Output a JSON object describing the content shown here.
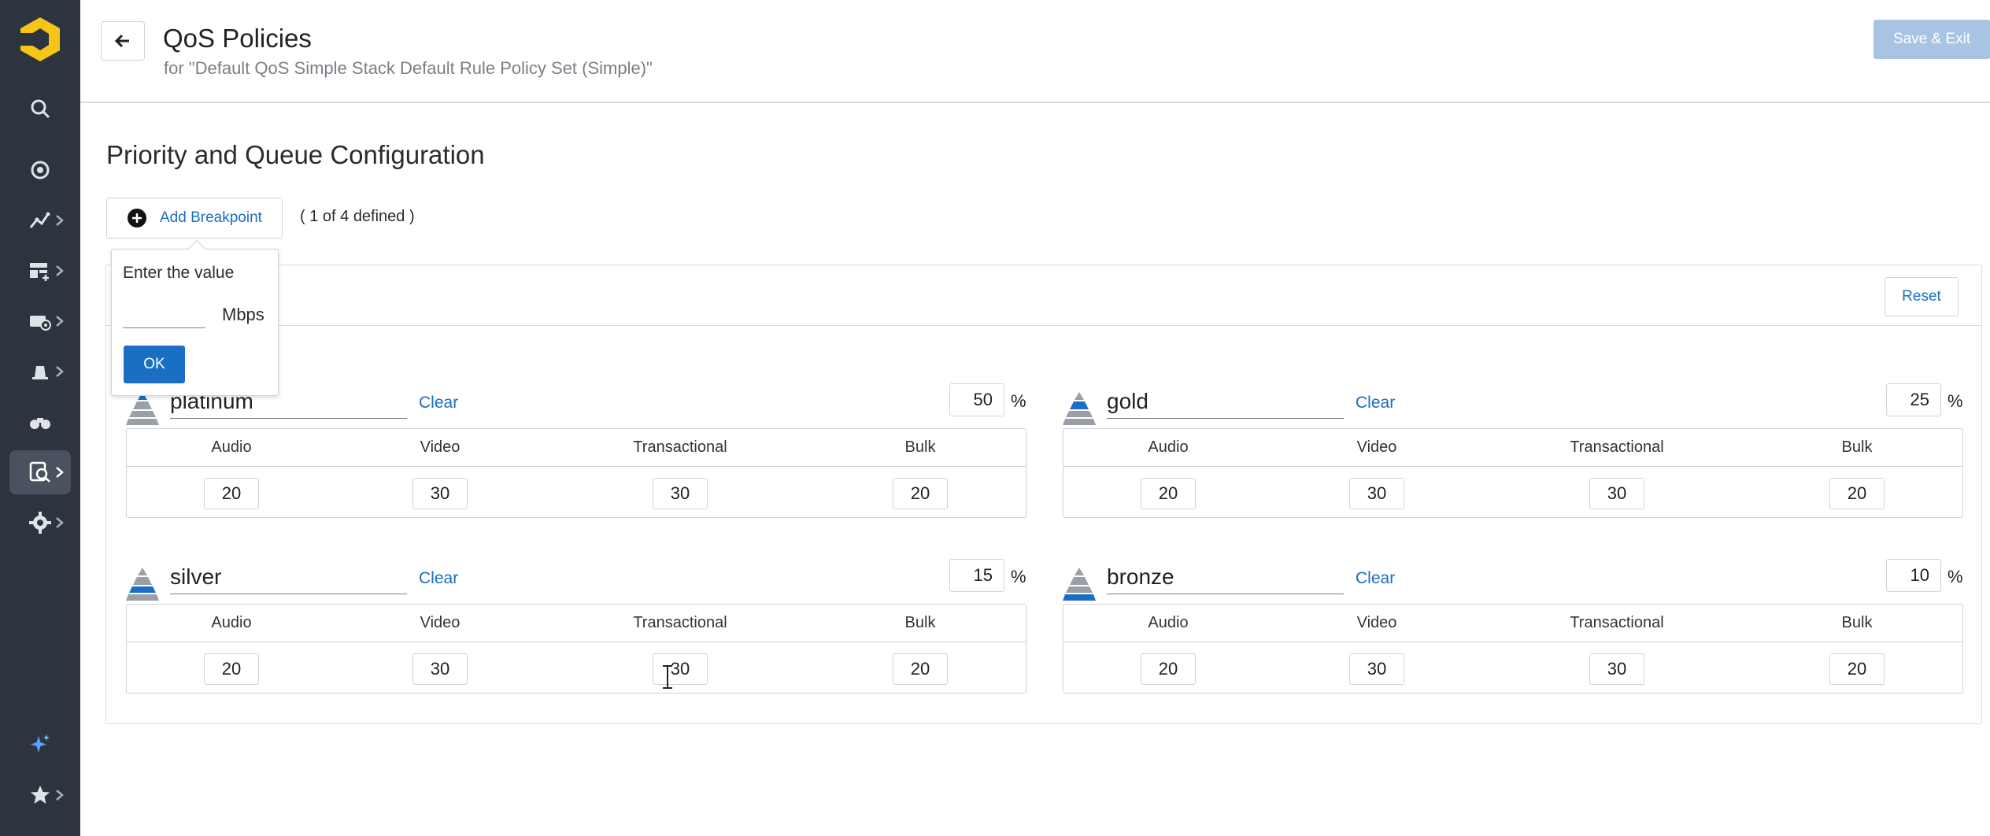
{
  "header": {
    "title": "QoS Policies",
    "subtitle": "for \"Default QoS Simple Stack Default Rule Policy Set (Simple)\"",
    "save_exit_label": "Save & Exit"
  },
  "sidebar": {
    "items": [
      {
        "icon": "search-icon"
      },
      {
        "icon": "target-icon"
      },
      {
        "icon": "analytics-icon"
      },
      {
        "icon": "dashboard-add-icon"
      },
      {
        "icon": "devices-icon"
      },
      {
        "icon": "alerts-icon"
      },
      {
        "icon": "binoculars-icon"
      },
      {
        "icon": "policy-search-icon",
        "active": true
      },
      {
        "icon": "gear-icon"
      },
      {
        "icon": "sparkle-icon"
      },
      {
        "icon": "star-icon"
      }
    ]
  },
  "main": {
    "section_title": "Priority and Queue Configuration",
    "add_breakpoint_label": "Add Breakpoint",
    "breakpoint_count": "( 1 of 4 defined )",
    "reset_label": "Reset",
    "columns": [
      "Audio",
      "Video",
      "Transactional",
      "Bulk"
    ],
    "clear_label": "Clear",
    "percent_sign": "%",
    "policies": [
      {
        "name": "platinum",
        "percent": "50",
        "values": [
          "20",
          "30",
          "30",
          "20"
        ],
        "level": 1
      },
      {
        "name": "gold",
        "percent": "25",
        "values": [
          "20",
          "30",
          "30",
          "20"
        ],
        "level": 2
      },
      {
        "name": "silver",
        "percent": "15",
        "values": [
          "20",
          "30",
          "30",
          "20"
        ],
        "level": 3
      },
      {
        "name": "bronze",
        "percent": "10",
        "values": [
          "20",
          "30",
          "30",
          "20"
        ],
        "level": 4
      }
    ]
  },
  "popover": {
    "title": "Enter the value",
    "unit": "Mbps",
    "ok_label": "OK"
  },
  "colors": {
    "sidebar_bg": "#2c3440",
    "accent": "#1a6fc4",
    "logo": "#f5c518",
    "save_disabled": "#a9c4e2"
  }
}
